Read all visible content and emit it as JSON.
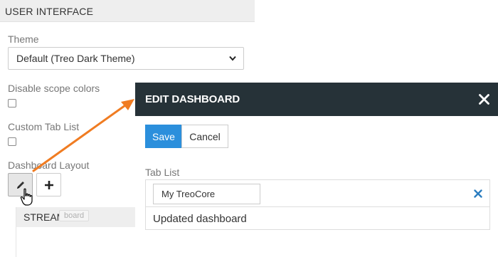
{
  "settings": {
    "section_title": "USER INTERFACE",
    "theme_label": "Theme",
    "theme_value": "Default (Treo Dark Theme)",
    "disable_scope_colors_label": "Disable scope colors",
    "custom_tab_list_label": "Custom Tab List",
    "dashboard_layout_label": "Dashboard Layout",
    "stream_tab_label": "STREAM",
    "tooltip_text": "board"
  },
  "icons": {
    "edit": "pencil-icon",
    "add": "plus-icon",
    "cursor": "hand-cursor-icon",
    "close": "close-icon",
    "remove": "remove-icon",
    "select": "chevron-down-icon"
  },
  "colors": {
    "modal_header_bg": "#263238",
    "primary": "#2b8fdc",
    "arrow": "#f07c22",
    "remove_x": "#2b7dc0"
  },
  "modal": {
    "title": "EDIT DASHBOARD",
    "save_label": "Save",
    "cancel_label": "Cancel",
    "tab_list_label": "Tab List",
    "tab_name_value": "My TreoCore",
    "tab_text": "Updated dashboard"
  }
}
